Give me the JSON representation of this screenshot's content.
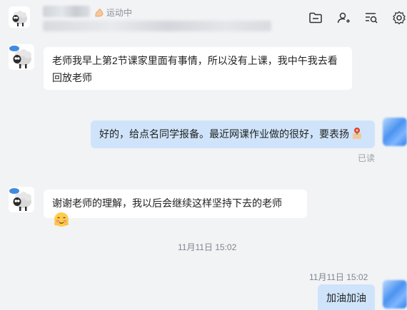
{
  "header": {
    "status_text": "运动中",
    "icons": [
      "folder-icon",
      "add-contact-icon",
      "search-history-icon",
      "settings-icon"
    ]
  },
  "messages": [
    {
      "from": "contact",
      "text_line1": "老师我早上第2节课家里面有事情，所以没有上课，我中午我去看",
      "text_line2": "回放老师"
    },
    {
      "from": "me",
      "text": "好的，给点名同学报备。最近网课作业做的很好，要表扬",
      "emoji": "award-emoji",
      "status": "已读"
    },
    {
      "from": "contact",
      "text": "谢谢老师的理解，我以后会继续这样坚持下去的老师",
      "emoji": "shy-smile-emoji"
    },
    {
      "timestamp": "11月11日 15:02"
    },
    {
      "from": "me",
      "time": "11月11日 15:02",
      "text": "加油加油"
    }
  ],
  "colors": {
    "background": "#f2f3f5",
    "incoming_bubble": "#ffffff",
    "outgoing_bubble": "#cfe4fb"
  }
}
